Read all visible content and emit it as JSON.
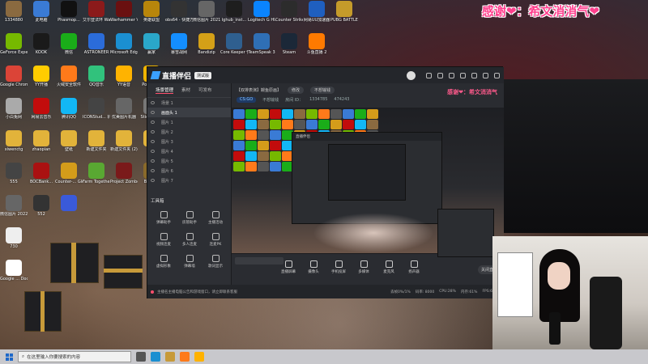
{
  "top_title": "感谢❤：希文消消气❤",
  "desktop": {
    "icons": [
      {
        "label": "1334880",
        "icon": "user-folder-icon",
        "color": "#8a6a40",
        "col": 0,
        "row": 0
      },
      {
        "label": "此电脑",
        "icon": "computer-icon",
        "color": "#3a7bd5",
        "col": 1,
        "row": 0
      },
      {
        "label": "Phasmop...",
        "icon": "phasmophobia-icon",
        "color": "#111111",
        "col": 2,
        "row": 0
      },
      {
        "label": "艾尔登法环 Warhammer",
        "icon": "warhammer-icon",
        "color": "#8b1a1a",
        "col": 3,
        "row": 0
      },
      {
        "label": "Warhammer Vermintide",
        "icon": "vermintide-icon",
        "color": "#6a1010",
        "col": 4,
        "row": 0
      },
      {
        "label": "英雄联盟",
        "icon": "lol-icon",
        "color": "#b8860b",
        "col": 5,
        "row": 0
      },
      {
        "label": "obs64 - 快捷方式",
        "icon": "obs-icon",
        "color": "#333333",
        "col": 6,
        "row": 0
      },
      {
        "label": "微信图片 2021111...",
        "icon": "image-file-icon",
        "color": "#666666",
        "col": 7,
        "row": 0
      },
      {
        "label": "lghub_inst...",
        "icon": "logitech-installer-icon",
        "color": "#1e1e1e",
        "col": 8,
        "row": 0
      },
      {
        "label": "Logitech G HUB",
        "icon": "logitech-icon",
        "color": "#0a84ff",
        "col": 9,
        "row": 0
      },
      {
        "label": "Counter Strike Online",
        "icon": "cso-icon",
        "color": "#2c2c2c",
        "col": 10,
        "row": 0
      },
      {
        "label": "网易UU加速器",
        "icon": "uu-icon",
        "color": "#1f5fbf",
        "col": 11,
        "row": 0
      },
      {
        "label": "PUBG BATTLEGR...",
        "icon": "pubg-icon",
        "color": "#c59b2a",
        "col": 12,
        "row": 0
      },
      {
        "label": "GeForce Experience",
        "icon": "geforce-icon",
        "color": "#76b900",
        "col": 0,
        "row": 1
      },
      {
        "label": "KOOK",
        "icon": "kook-icon",
        "color": "#1a1a1a",
        "col": 1,
        "row": 1
      },
      {
        "label": "微信",
        "icon": "wechat-icon",
        "color": "#1aad19",
        "col": 2,
        "row": 1
      },
      {
        "label": "ASTRONEER",
        "icon": "astroneer-icon",
        "color": "#2b6cd9",
        "col": 3,
        "row": 1
      },
      {
        "label": "Microsoft Edge",
        "icon": "edge-icon",
        "color": "#1b8fd1",
        "col": 4,
        "row": 1
      },
      {
        "label": "赢家",
        "icon": "winner-icon",
        "color": "#2aa7c9",
        "col": 5,
        "row": 1
      },
      {
        "label": "暴雪战网",
        "icon": "battlenet-icon",
        "color": "#148eff",
        "col": 6,
        "row": 1
      },
      {
        "label": "Bandizip",
        "icon": "bandizip-icon",
        "color": "#d4a017",
        "col": 7,
        "row": 1
      },
      {
        "label": "Core Keeper 快...",
        "icon": "core-keeper-icon",
        "color": "#2f5f8f",
        "col": 8,
        "row": 1
      },
      {
        "label": "TeamSpeak 3",
        "icon": "teamspeak-icon",
        "color": "#2f6fb5",
        "col": 9,
        "row": 1
      },
      {
        "label": "Steam",
        "icon": "steam-icon",
        "color": "#1b2838",
        "col": 10,
        "row": 1
      },
      {
        "label": "斗鱼直播 2",
        "icon": "douyu-icon",
        "color": "#ff7a00",
        "col": 11,
        "row": 1
      },
      {
        "label": "Google Chrome",
        "icon": "chrome-icon",
        "color": "#db4437",
        "col": 0,
        "row": 2
      },
      {
        "label": "YY开播",
        "icon": "yy-icon",
        "color": "#ffcc00",
        "col": 1,
        "row": 2
      },
      {
        "label": "火绒安全软件",
        "icon": "huorong-icon",
        "color": "#ff7a1a",
        "col": 2,
        "row": 2
      },
      {
        "label": "QQ音乐",
        "icon": "qqmusic-icon",
        "color": "#31c27c",
        "col": 3,
        "row": 2
      },
      {
        "label": "YY语音",
        "icon": "yy-voice-icon",
        "color": "#ffb300",
        "col": 4,
        "row": 2
      },
      {
        "label": "PotPlayer",
        "icon": "potplayer-icon",
        "color": "#f0b400",
        "col": 5,
        "row": 2
      },
      {
        "label": "小白兔网",
        "icon": "rabbit-icon",
        "color": "#aaaaaa",
        "col": 0,
        "row": 3
      },
      {
        "label": "网易云音乐",
        "icon": "netease-music-icon",
        "color": "#c20c0c",
        "col": 1,
        "row": 3
      },
      {
        "label": "腾讯QQ",
        "icon": "qq-icon",
        "color": "#12b7f5",
        "col": 2,
        "row": 3
      },
      {
        "label": "ICONStud... 机器",
        "icon": "iconstudio-icon",
        "color": "#444444",
        "col": 3,
        "row": 3
      },
      {
        "label": "优美图片机器",
        "icon": "picture-icon",
        "color": "#666666",
        "col": 4,
        "row": 3
      },
      {
        "label": "Sticker GIF",
        "icon": "sticker-icon",
        "color": "#777777",
        "col": 5,
        "row": 3
      },
      {
        "label": "xiwenctg",
        "icon": "folder-icon",
        "color": "#e2b33a",
        "col": 0,
        "row": 4
      },
      {
        "label": "zhaopian",
        "icon": "folder-icon",
        "color": "#e2b33a",
        "col": 1,
        "row": 4
      },
      {
        "label": "壁纸",
        "icon": "folder-icon",
        "color": "#e2b33a",
        "col": 2,
        "row": 4
      },
      {
        "label": "新建文件夹",
        "icon": "folder-icon",
        "color": "#e2b33a",
        "col": 3,
        "row": 4
      },
      {
        "label": "新建文件夹 (2)",
        "icon": "folder-icon",
        "color": "#e2b33a",
        "col": 4,
        "row": 4
      },
      {
        "label": "5c",
        "icon": "folder-icon",
        "color": "#e2b33a",
        "col": 5,
        "row": 4
      },
      {
        "label": "555",
        "icon": "game-icon",
        "color": "#444444",
        "col": 0,
        "row": 5
      },
      {
        "label": "BOCBank...",
        "icon": "bank-icon",
        "color": "#aa1111",
        "col": 1,
        "row": 5
      },
      {
        "label": "Counter-... Global Off...",
        "icon": "csgo-icon",
        "color": "#d49c1a",
        "col": 2,
        "row": 5
      },
      {
        "label": "Farm Together",
        "icon": "farm-icon",
        "color": "#59a832",
        "col": 3,
        "row": 5
      },
      {
        "label": "Project Zomboid",
        "icon": "zomboid-icon",
        "color": "#7a1a1a",
        "col": 4,
        "row": 5
      },
      {
        "label": "Brotato",
        "icon": "brotato-icon",
        "color": "#8a6a2a",
        "col": 5,
        "row": 5
      },
      {
        "label": "微信图片 2022011...",
        "icon": "image-file-icon",
        "color": "#666666",
        "col": 0,
        "row": 6
      },
      {
        "label": "552",
        "icon": "game-icon",
        "color": "#333333",
        "col": 1,
        "row": 6
      },
      {
        "label": "",
        "icon": "anime-icon",
        "color": "#3a5ad9",
        "col": 2,
        "row": 6
      },
      {
        "label": "730",
        "icon": "text-file-icon",
        "color": "#eeeeee",
        "col": 0,
        "row": 7
      },
      {
        "label": "Google ... Doodle Jack",
        "icon": "doodle-icon",
        "color": "#ffffff",
        "col": 0,
        "row": 8
      }
    ]
  },
  "app": {
    "name": "直播伴侣",
    "badge": "测试版",
    "left_tabs": [
      "场景管理",
      "素材",
      "可发布"
    ],
    "scenes": [
      "场景 1",
      "画面头 1",
      "图片 1",
      "图片 2",
      "图片 3",
      "图片 4",
      "图片 5",
      "图片 6",
      "图片 7"
    ],
    "selected_scene_index": 1,
    "tools_title": "工具箱",
    "tools": [
      {
        "label": "弹幕助手",
        "icon": "danmaku-icon"
      },
      {
        "label": "房管助手",
        "icon": "admin-icon"
      },
      {
        "label": "主播活动",
        "icon": "event-icon"
      },
      {
        "label": "视频连麦",
        "icon": "video-link-icon"
      },
      {
        "label": "多人连麦",
        "icon": "multi-link-icon"
      },
      {
        "label": "连麦PK",
        "icon": "pk-icon"
      },
      {
        "label": "虚拟形象",
        "icon": "avatar-icon"
      },
      {
        "label": "弹幕墙",
        "icon": "wall-icon"
      },
      {
        "label": "歌词显示",
        "icon": "lyrics-icon"
      }
    ],
    "room": {
      "title": "【双排表演】鳗鱼原画】",
      "edit_label": "修改",
      "extra_label": "不想输钱",
      "game": "CS:GO",
      "game_sub": "不想输钱",
      "room_id_label": "房间 ID：",
      "room_id": "1334785",
      "fans": "474243"
    },
    "overlay_text": "感谢❤：希文消消气",
    "controls": [
      {
        "label": "直播屏幕",
        "icon": "screen-icon"
      },
      {
        "label": "摄像头",
        "icon": "camera-icon"
      },
      {
        "label": "手机投屏",
        "icon": "phone-cast-icon"
      },
      {
        "label": "多媒体",
        "icon": "media-icon"
      },
      {
        "label": "麦克风",
        "icon": "mic-icon"
      },
      {
        "label": "扬声器",
        "icon": "speaker-icon"
      }
    ],
    "start_label": "关闭直播",
    "status_text": "主播名主播电脑公告和游戏窗口，请立即联系客服",
    "status_metrics": [
      "丢帧0%/1%",
      "码率: 8000",
      "CPU:28%",
      "内存:61%",
      "FPS:60.00"
    ]
  },
  "taskbar": {
    "search_placeholder": "在这里输入你要搜索的内容",
    "pinned": [
      {
        "icon": "task-view-icon",
        "color": "#555555"
      },
      {
        "icon": "edge-icon",
        "color": "#1b8fd1"
      },
      {
        "icon": "steam-icon",
        "color": "#c79a3a"
      },
      {
        "icon": "orange-app-icon",
        "color": "#ff7a1a"
      },
      {
        "icon": "douyin-icon",
        "color": "#ffb200"
      }
    ]
  }
}
